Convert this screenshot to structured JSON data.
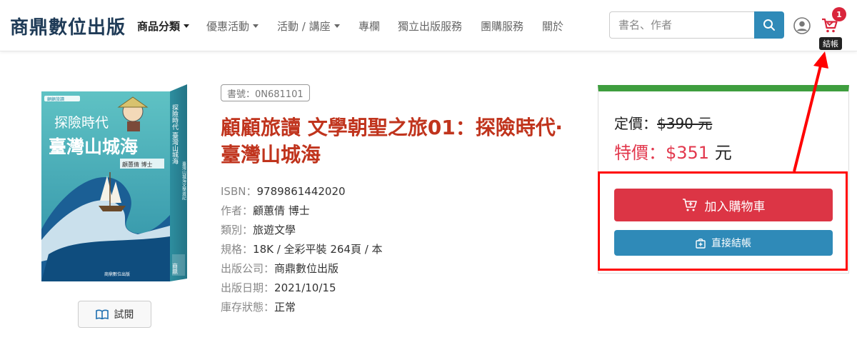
{
  "brand": "商鼎數位出版",
  "nav": [
    {
      "label": "商品分類",
      "dropdown": true,
      "active": true
    },
    {
      "label": "優惠活動",
      "dropdown": true,
      "active": false
    },
    {
      "label": "活動 / 講座",
      "dropdown": true,
      "active": false
    },
    {
      "label": "專欄",
      "dropdown": false,
      "active": false
    },
    {
      "label": "獨立出版服務",
      "dropdown": false,
      "active": false
    },
    {
      "label": "團購服務",
      "dropdown": false,
      "active": false
    },
    {
      "label": "關於",
      "dropdown": false,
      "active": false
    }
  ],
  "search": {
    "placeholder": "書名、作者",
    "value": "",
    "icon": "search-icon"
  },
  "cart": {
    "badge_count": "1",
    "tooltip": "結帳",
    "icon": "cart-icon",
    "color": "#d9253b"
  },
  "user_icon": "user-circle-icon",
  "book": {
    "sku": "書號：0N681101",
    "title": "顧顧旅讀 文學朝聖之旅01：探險時代‧臺灣山城海",
    "cover": {
      "title_line1": "探險時代",
      "title_line2": "臺灣山城海",
      "author": "顧蕙倩 博士",
      "side_title": "探險時代 臺灣山城海",
      "side_subtitle": "臺灣山城海文學遊記",
      "publisher_mark": "商鼎",
      "publisher_footer": "商鼎數位出版",
      "series_tag": "顧顧旅讀"
    },
    "preview_label": "試閱",
    "meta": [
      {
        "label": "ISBN",
        "value": "9789861442020"
      },
      {
        "label": "作者",
        "value": "顧蕙倩 博士"
      },
      {
        "label": "類別",
        "value": "旅遊文學"
      },
      {
        "label": "規格",
        "value": "18K / 全彩平裝 264頁 / 本"
      },
      {
        "label": "出版公司",
        "value": "商鼎數位出版"
      },
      {
        "label": "出版日期",
        "value": "2021/10/15"
      },
      {
        "label": "庫存狀態",
        "value": "正常"
      }
    ]
  },
  "price": {
    "list_label": "定價：",
    "list_value": "$390 元",
    "sale_label": "特價：",
    "sale_value": "$351",
    "sale_unit": "元",
    "accent_color": "#3e9e3e",
    "add_to_cart": "加入購物車",
    "checkout": "直接結帳"
  },
  "colors": {
    "title": "#c0341d",
    "sale": "#e2384d",
    "danger": "#dc3545",
    "info": "#2f8ab8",
    "annotation": "#ff0000"
  }
}
